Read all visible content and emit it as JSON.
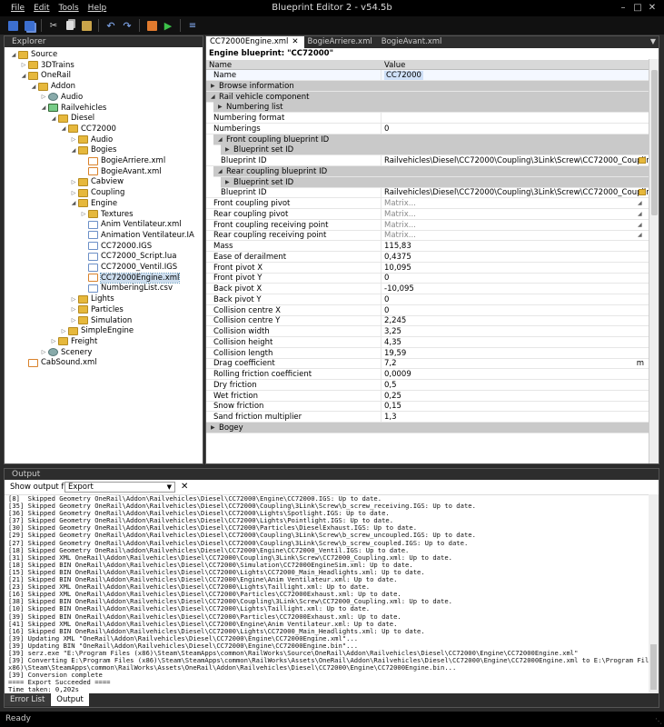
{
  "window": {
    "title": "Blueprint Editor 2 - v54.5b"
  },
  "menu": [
    "File",
    "Edit",
    "Tools",
    "Help"
  ],
  "toolbar": [
    "save-icon",
    "save-all-icon",
    "cut-icon",
    "copy-icon",
    "paste-icon",
    "undo-icon",
    "redo-icon",
    "export-icon",
    "run-icon",
    "options-icon"
  ],
  "explorer": {
    "title": "Explorer",
    "nodes": [
      {
        "label": "Source",
        "depth": 0,
        "icon": "folder",
        "arrow": "open"
      },
      {
        "label": "3DTrains",
        "depth": 1,
        "icon": "folder",
        "arrow": "closed"
      },
      {
        "label": "OneRail",
        "depth": 1,
        "icon": "folder",
        "arrow": "open"
      },
      {
        "label": "Addon",
        "depth": 2,
        "icon": "folder",
        "arrow": "open"
      },
      {
        "label": "Audio",
        "depth": 3,
        "icon": "gear",
        "arrow": "closed"
      },
      {
        "label": "Railvehicles",
        "depth": 3,
        "icon": "train",
        "arrow": "open"
      },
      {
        "label": "Diesel",
        "depth": 4,
        "icon": "folder",
        "arrow": "open"
      },
      {
        "label": "CC72000",
        "depth": 5,
        "icon": "folder",
        "arrow": "open"
      },
      {
        "label": "Audio",
        "depth": 6,
        "icon": "folder",
        "arrow": "closed"
      },
      {
        "label": "Bogies",
        "depth": 6,
        "icon": "folder",
        "arrow": "open"
      },
      {
        "label": "BogieArriere.xml",
        "depth": 7,
        "icon": "xml",
        "arrow": ""
      },
      {
        "label": "BogieAvant.xml",
        "depth": 7,
        "icon": "xml",
        "arrow": ""
      },
      {
        "label": "Cabview",
        "depth": 6,
        "icon": "folder",
        "arrow": "closed"
      },
      {
        "label": "Coupling",
        "depth": 6,
        "icon": "folder",
        "arrow": "closed"
      },
      {
        "label": "Engine",
        "depth": 6,
        "icon": "folder",
        "arrow": "open"
      },
      {
        "label": "Textures",
        "depth": 7,
        "icon": "folder",
        "arrow": "closed"
      },
      {
        "label": "Anim Ventilateur.xml",
        "depth": 7,
        "icon": "file",
        "arrow": ""
      },
      {
        "label": "Animation Ventilateur.IA",
        "depth": 7,
        "icon": "file",
        "arrow": ""
      },
      {
        "label": "CC72000.IGS",
        "depth": 7,
        "icon": "file",
        "arrow": ""
      },
      {
        "label": "CC72000_Script.lua",
        "depth": 7,
        "icon": "file",
        "arrow": ""
      },
      {
        "label": "CC72000_Ventil.IGS",
        "depth": 7,
        "icon": "file",
        "arrow": ""
      },
      {
        "label": "CC72000Engine.xml",
        "depth": 7,
        "icon": "xml",
        "arrow": "",
        "selected": true
      },
      {
        "label": "NumberingList.csv",
        "depth": 7,
        "icon": "file",
        "arrow": ""
      },
      {
        "label": "Lights",
        "depth": 6,
        "icon": "folder",
        "arrow": "closed"
      },
      {
        "label": "Particles",
        "depth": 6,
        "icon": "folder",
        "arrow": "closed"
      },
      {
        "label": "Simulation",
        "depth": 6,
        "icon": "folder",
        "arrow": "closed"
      },
      {
        "label": "SimpleEngine",
        "depth": 5,
        "icon": "folder",
        "arrow": "closed"
      },
      {
        "label": "Freight",
        "depth": 4,
        "icon": "folder",
        "arrow": "closed"
      },
      {
        "label": "Scenery",
        "depth": 3,
        "icon": "gear",
        "arrow": "closed"
      },
      {
        "label": "CabSound.xml",
        "depth": 1,
        "icon": "xml",
        "arrow": ""
      }
    ]
  },
  "editor": {
    "tabs": [
      {
        "label": "CC72000Engine.xml",
        "active": true
      },
      {
        "label": "BogieArriere.xml",
        "active": false
      },
      {
        "label": "BogieAvant.xml",
        "active": false
      }
    ],
    "blueprint_title": "Engine blueprint: \"CC72000\"",
    "col_name": "Name",
    "col_value": "Value",
    "rows": [
      {
        "k": "Name",
        "v": "CC72000",
        "type": "selected"
      },
      {
        "k": "Browse information",
        "type": "sect",
        "indent": 0
      },
      {
        "k": "Rail vehicle component",
        "type": "sect",
        "indent": 0,
        "open": true
      },
      {
        "k": "Numbering list",
        "type": "sect",
        "indent": 1
      },
      {
        "k": "Numbering format",
        "v": ""
      },
      {
        "k": "Numberings",
        "v": "0"
      },
      {
        "k": "Front coupling blueprint ID",
        "type": "sect",
        "indent": 1,
        "open": true
      },
      {
        "k": "Blueprint set ID",
        "type": "sect",
        "indent": 2
      },
      {
        "k": "Blueprint ID",
        "v": "Railvehicles\\Diesel\\CC72000\\Coupling\\3Link\\Screw\\CC72000_Coupling.xml",
        "type": "folder",
        "indent": 1
      },
      {
        "k": "Rear coupling blueprint ID",
        "type": "sect",
        "indent": 1,
        "open": true
      },
      {
        "k": "Blueprint set ID",
        "type": "sect",
        "indent": 2
      },
      {
        "k": "Blueprint ID",
        "v": "Railvehicles\\Diesel\\CC72000\\Coupling\\3Link\\Screw\\CC72000_Coupling.xml",
        "type": "folder",
        "indent": 1
      },
      {
        "k": "Front coupling pivot",
        "v": "Matrix...",
        "type": "matrix"
      },
      {
        "k": "Rear coupling pivot",
        "v": "Matrix...",
        "type": "matrix"
      },
      {
        "k": "Front coupling receiving point",
        "v": "Matrix...",
        "type": "matrix"
      },
      {
        "k": "Rear coupling receiving point",
        "v": "Matrix...",
        "type": "matrix"
      },
      {
        "k": "Mass",
        "v": "115,83"
      },
      {
        "k": "Ease of derailment",
        "v": "0,4375"
      },
      {
        "k": "Front pivot X",
        "v": "10,095"
      },
      {
        "k": "Front pivot Y",
        "v": "0"
      },
      {
        "k": "Back pivot X",
        "v": "-10,095"
      },
      {
        "k": "Back pivot Y",
        "v": "0"
      },
      {
        "k": "Collision centre X",
        "v": "0"
      },
      {
        "k": "Collision centre Y",
        "v": "2,245"
      },
      {
        "k": "Collision width",
        "v": "3,25"
      },
      {
        "k": "Collision height",
        "v": "4,35"
      },
      {
        "k": "Collision length",
        "v": "19,59"
      },
      {
        "k": "Drag coefficient",
        "v": "7,2",
        "unit": "m"
      },
      {
        "k": "Rolling friction coefficient",
        "v": "0,0009"
      },
      {
        "k": "Dry friction",
        "v": "0,5"
      },
      {
        "k": "Wet friction",
        "v": "0,25"
      },
      {
        "k": "Snow friction",
        "v": "0,15"
      },
      {
        "k": "Sand friction multiplier",
        "v": "1,3"
      },
      {
        "k": "Bogey",
        "type": "sect",
        "indent": 0
      }
    ]
  },
  "output": {
    "title": "Output",
    "show_from_label": "Show output from:",
    "show_from_value": "Export",
    "lines": [
      "[8]  Skipped Geometry OneRail\\Addon\\Railvehicles\\Diesel\\CC72000\\Engine\\CC72000.IGS: Up to date.",
      "[35] Skipped Geometry OneRail\\Addon\\Railvehicles\\Diesel\\CC72000\\Coupling\\3Link\\Screw\\b_screw_receiving.IGS: Up to date.",
      "[36] Skipped Geometry OneRail\\Addon\\Railvehicles\\Diesel\\CC72000\\Lights\\Spotlight.IGS: Up to date.",
      "[37] Skipped Geometry OneRail\\Addon\\Railvehicles\\Diesel\\CC72000\\Lights\\Pointlight.IGS: Up to date.",
      "[30] Skipped Geometry OneRail\\Addon\\Railvehicles\\Diesel\\CC72000\\Particles\\DieselExhaust.IGS: Up to date.",
      "[29] Skipped Geometry OneRail\\Addon\\Railvehicles\\Diesel\\CC72000\\Coupling\\3Link\\Screw\\b_screw_uncoupled.IGS: Up to date.",
      "[27] Skipped Geometry OneRail\\Addon\\Railvehicles\\Diesel\\CC72000\\Coupling\\3Link\\Screw\\b_screw_coupled.IGS: Up to date.",
      "[18] Skipped Geometry OneRail\\addon\\Railvehicles\\Diesel\\CC72000\\Engine\\CC72000_Ventil.IGS: Up to date.",
      "[31] Skipped XML OneRail\\Addon\\Railvehicles\\Diesel\\CC72000\\Coupling\\3Link\\Screw\\CC72000_Coupling.xml: Up to date.",
      "[18] Skipped BIN OneRail\\Addon\\Railvehicles\\Diesel\\CC72000\\Simulation\\CC72000EngineSim.xml: Up to date.",
      "[15] Skipped BIN OneRail\\Addon\\Railvehicles\\Diesel\\CC72000\\Lights\\CC72000_Main_Headlights.xml: Up to date.",
      "[21] Skipped BIN OneRail\\Addon\\Railvehicles\\Diesel\\CC72000\\Engine\\Anim Ventilateur.xml: Up to date.",
      "[23] Skipped XML OneRail\\Addon\\Railvehicles\\Diesel\\CC72000\\Lights\\Taillight.xml: Up to date.",
      "[16] Skipped XML OneRail\\Addon\\Railvehicles\\Diesel\\CC72000\\Particles\\CC72000Exhaust.xml: Up to date.",
      "[38] Skipped BIN OneRail\\Addon\\Railvehicles\\Diesel\\CC72000\\Coupling\\3Link\\Screw\\CC72000_Coupling.xml: Up to date.",
      "[10] Skipped BIN OneRail\\Addon\\Railvehicles\\Diesel\\CC72000\\Lights\\Taillight.xml: Up to date.",
      "[39] Skipped BIN OneRail\\Addon\\Railvehicles\\Diesel\\CC72000\\Particles\\CC72000Exhaust.xml: Up to date.",
      "[41] Skipped XML OneRail\\Addon\\Railvehicles\\Diesel\\CC72000\\Engine\\Anim Ventilateur.xml: Up to date.",
      "[16] Skipped BIN OneRail\\Addon\\Railvehicles\\Diesel\\CC72000\\Lights\\CC72000_Main_Headlights.xml: Up to date.",
      "[39] Updating XML \"OneRail\\Addon\\Railvehicles\\Diesel\\CC72000\\Engine\\CC72000Engine.xml\"...",
      "[39] Updating BIN \"OneRail\\Addon\\Railvehicles\\Diesel\\CC72000\\Engine\\CC72000Engine.bin\"...",
      "[39] serz.exe \"E:\\Program Files (x86)\\Steam\\SteamApps\\common\\RailWorks\\Source\\OneRail\\Addon\\Railvehicles\\Diesel\\CC72000\\Engine\\CC72000Engine.xml\"",
      "[39] Converting E:\\Program Files (x86)\\Steam\\SteamApps\\common\\RailWorks\\Assets\\OneRail\\Addon\\Railvehicles\\Diesel\\CC72000\\Engine\\CC72000Engine.xml to E:\\Program Files",
      "x86)\\Steam\\SteamApps\\common\\RailWorks\\Assets\\OneRail\\Addon\\Railvehicles\\Diesel\\CC72000\\Engine\\CC72000Engine.bin...",
      "[39] Conversion complete",
      "==== Export Succeeded ====",
      "Time taken: 0,202s"
    ],
    "tabs": [
      {
        "label": "Error List",
        "active": false
      },
      {
        "label": "Output",
        "active": true
      }
    ]
  },
  "status": {
    "text": "Ready"
  },
  "colors": {
    "chrome": "#000000",
    "panel_header": "#2d2d2d",
    "section_row": "#c9c9c9",
    "selected_value": "#cfe0f7"
  }
}
